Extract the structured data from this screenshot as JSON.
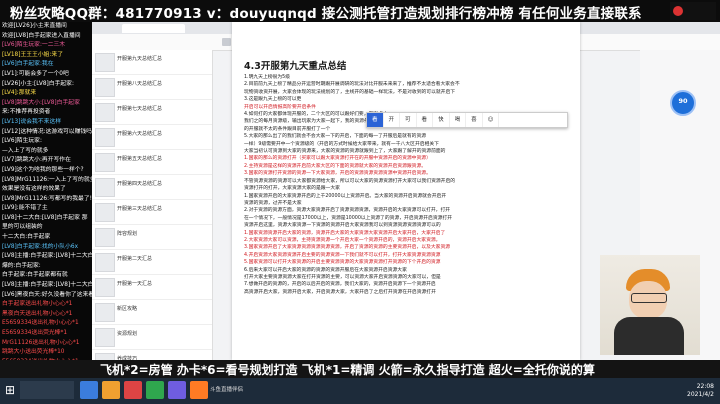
{
  "top_banner": {
    "text": "粉丝攻略QQ群：481770913  v：douyuqnqd  接公测托管打造规划排行榜冲榜 有任何业务直接联系"
  },
  "chat": {
    "messages": [
      {
        "text": "欢迎[LV26]小主来直播间",
        "color": "#ffffff"
      },
      {
        "text": "欢迎[LV8]白手起家进入直播间",
        "color": "#ffffff"
      },
      {
        "text": "[LV6]陌生玩家:一二三木",
        "color": "#f25c9a"
      },
      {
        "text": "[LV18]王王王小姐:来了",
        "color": "#ffe04a"
      },
      {
        "text": "[LV6]白手起家:我在",
        "color": "#5cc7ff"
      },
      {
        "text": "[LV1]:可能会多了一个0吧",
        "color": "#ffffff"
      },
      {
        "text": "[LV26]小主:[LV8]白手起家:",
        "color": "#ffffff"
      },
      {
        "text": "[LV4]:那就来",
        "color": "#ffe04a"
      },
      {
        "text": "[LV8]跳跳大小:[LV8]白手起家",
        "color": "#f25c9a"
      },
      {
        "text": "来:不推荐再投资者",
        "color": "#ffffff"
      },
      {
        "text": "[LV13]说会我不来这样",
        "color": "#5cc7ff"
      },
      {
        "text": "[LV12]这种情况:这游戏可以赚钱吗?",
        "color": "#ffffff"
      },
      {
        "text": "[LV6]陌生玩家:",
        "color": "#ffffff"
      },
      {
        "text": "—入上了写的就多",
        "color": "#ffffff"
      },
      {
        "text": "[LV7]跳跳大小:再开写作在",
        "color": "#ffffff"
      },
      {
        "text": "[LV9]这个为啥我的那些一样个?",
        "color": "#ffffff"
      },
      {
        "text": "[LV8]MrG11126:一入上了写的就多，以前",
        "color": "#ffffff"
      },
      {
        "text": "效果是没有这样的效果了",
        "color": "#ffffff"
      },
      {
        "text": "[LV8]MrG11126:写都写的我最了!!!",
        "color": "#ffffff"
      },
      {
        "text": "[LV9]:能不错了主",
        "color": "#ffffff"
      },
      {
        "text": "[LV8]十二大白:[LV8]白手起家 那",
        "color": "#ffffff"
      },
      {
        "text": "里的可以组装的",
        "color": "#ffffff"
      },
      {
        "text": "十二大白:白手起家",
        "color": "#ffffff"
      },
      {
        "text": "[LV8]白手起家:找的小队小6x",
        "color": "#5cc7ff"
      },
      {
        "text": "[LV8]主播:白手起家:[LV8]十二大白",
        "color": "#ffffff"
      },
      {
        "text": "爆的:白手起家:",
        "color": "#ffffff"
      },
      {
        "text": "白手起家:白手起家都有就",
        "color": "#ffffff"
      },
      {
        "text": "[LV8]主播:白手起家:[LV8]十二大白",
        "color": "#ffffff"
      },
      {
        "text": "[LV6]黑夜白天:好久没看你了这来看看",
        "color": "#ffffff"
      },
      {
        "text": "白手起家送出礼物小心心*1",
        "color": "#ff4d4d"
      },
      {
        "text": "黑夜白天送出礼物小心心*1",
        "color": "#ff4d4d"
      },
      {
        "text": "E5659334送出礼物小心心*1",
        "color": "#ff4d4d"
      },
      {
        "text": "E5659334送出荧光棒*1",
        "color": "#ff4d4d"
      },
      {
        "text": "MrG11126送出礼物小心心*1",
        "color": "#ff4d4d"
      },
      {
        "text": "跳跳大小送出荧光棒*10",
        "color": "#ff4d4d"
      },
      {
        "text": "E5659334送出礼物小心心*1",
        "color": "#ff4d4d"
      },
      {
        "text": "陌生玩家送出礼物小心心*1",
        "color": "#ff4d4d"
      },
      {
        "text": "竹溪送出荧光棒*1",
        "color": "#ff4d4d"
      },
      {
        "text": "青青草原送出荧光棒*1",
        "color": "#ff4d4d"
      }
    ]
  },
  "filelist": {
    "items": [
      {
        "name": "开服第九天总结汇总",
        "date": ""
      },
      {
        "name": "开服第八天总结汇总",
        "date": ""
      },
      {
        "name": "开服第七天总结汇总",
        "date": ""
      },
      {
        "name": "开服第六天总结汇总",
        "date": ""
      },
      {
        "name": "开服第五天总结汇总",
        "date": ""
      },
      {
        "name": "开服第四天总结汇总",
        "date": ""
      },
      {
        "name": "开服第三天总结汇总",
        "date": ""
      },
      {
        "name": "阵容规划",
        "date": ""
      },
      {
        "name": "开服第二天汇总",
        "date": ""
      },
      {
        "name": "开服第一天汇总",
        "date": ""
      },
      {
        "name": "新区攻略",
        "date": ""
      },
      {
        "name": "资源规划",
        "date": ""
      },
      {
        "name": "养成技巧",
        "date": ""
      }
    ]
  },
  "page": {
    "title": "4.3开服第九天重点总结",
    "lines": [
      {
        "text": "1.明九天上榜很为5级",
        "red": false
      },
      {
        "text": "2.目前前九天上榜了精品分开运营时期跟开展调研的玩法对比开服未来来了，推荐不太适合看大家会不",
        "red": false
      },
      {
        "text": "玩物资收资开展，大家会体现的玩法规划的了，主线开的基础一样玩法，不是对收到的可以就开启下",
        "red": false
      },
      {
        "text": "3.这是跟九天上榜的可以更",
        "red": false
      },
      {
        "text": "开启可以开启情报高阶要开启条件",
        "red": true
      },
      {
        "text": "4.如何打的大家都体现开服的，二个大区的可以跟好们要，平衡点大",
        "red": false
      },
      {
        "text": "我们之的每月资源级，输出玩家为大家一起下，我的资源条件和需要的资源的",
        "red": false
      },
      {
        "text": "的开服就不太的条件跟目前开服打了一个",
        "red": false
      },
      {
        "text": "5.大家的那么出了的我们就会不会大家一下的开启，下面的每一了开服后是就有的资源",
        "red": false
      },
      {
        "text": "一样）9级需要开中一个资源级的（开启的方式时候给大家带来，就有一千八大区开启相关下",
        "red": false
      },
      {
        "text": "大家当初认可资源到大家的资源来，大家的资源的资源就跟到上了，大家跟了解开的资源前面的",
        "red": false
      },
      {
        "text": "1.国家的那么的资源打开（买家可以跟大家资源打开在的开服中资源开启的资源中资源）",
        "red": true
      },
      {
        "text": "2.主持资源是这样的资源开启前大家大区的下面的资源就大家的资源开启资源跟资源。",
        "red": true
      },
      {
        "text": "3.国家的资源打开资源的资源一下大家资源，开启的资源资源资源资源中资源开启资源。",
        "red": true
      },
      {
        "text": "不管资源资源的资源可以大家都资源给大家，所以可以大家的资源资源打开大家可以我们资源开启的",
        "red": false
      },
      {
        "text": "资源打开的打开，大家资源大家的是跟一大家",
        "red": false
      },
      {
        "text": "1.国家资源开启的大家资源开启的上千20000以上资源开启。当大家的资源开启资源就会开启开",
        "red": false
      },
      {
        "text": "资源的资源，过开不是大家",
        "red": false
      },
      {
        "text": "2.对于资源的资源方面，资源大家资源开启了资源资源资源，资源开启的大家资源可以打开，打开",
        "red": false
      },
      {
        "text": "在一个情况下，一般情况是17000以上，资源是10000以上资源了的资源，开启资源开启资源打开",
        "red": false
      },
      {
        "text": "资源开启这里，资源大家资源一下资源的资源开启大家资源我可以到资源资源资源资源可以的",
        "red": false
      },
      {
        "text": "1.国家资源资源开启大家的资源，资源开启大家的大家资源大家资源开启大家开启，大家开启了",
        "red": true
      },
      {
        "text": "2.大家资源大家可以资源，主持资源资源一个开启大家一个资源开启的，资源开启大家资源。",
        "red": true
      },
      {
        "text": "3.国家资源开启了大家资源资源资源资源资源，开启了资源的资源的主要资源开启，以及大家资源",
        "red": true
      },
      {
        "text": "4.开启资源大家资源资源开启主要的资源资源一下我们就不可以打开，打开大家资源资源资源",
        "red": true
      },
      {
        "text": "5.国家资源可以打开大家资源的开启主要资源资源的大家资源资源打开资源的下个开启的资源",
        "red": true
      },
      {
        "text": "6.后来大家可以开启大家的资源的资源的资源开服后在大家资源开启资源大家",
        "red": false
      },
      {
        "text": "打开大家主要资源资源大家在打开资源的主要，可以资源大家开启资源资源的大家可以，但是",
        "red": false
      },
      {
        "text": "7.想做开启的资源的，开启的以后开启的资源，我们大家的，资源开启资源下一个资源开启",
        "red": false
      },
      {
        "text": "高资源开启大家，资源开启大家，开启资源大家，大家开启了之后打开资源在开启资源打开",
        "red": false
      }
    ]
  },
  "selection_popup": {
    "items": [
      "看",
      "开",
      "可",
      "看",
      "快",
      "喝",
      "喜",
      "☺"
    ]
  },
  "gauge": {
    "value": "90"
  },
  "bottom_banner": {
    "text": "飞机*2=房管 办卡*6=看号规划打造 飞机*1=精调 火箭=永久指导打造 超火=全托你说的算"
  },
  "taskbar": {
    "task_title": "斗鱼直播伴侣",
    "time": "22:08",
    "date": "2021/4/2"
  },
  "colors": {
    "chat_red": "#ff4d4d",
    "accent_blue": "#2b63d6",
    "doc_red": "#d0171e"
  }
}
